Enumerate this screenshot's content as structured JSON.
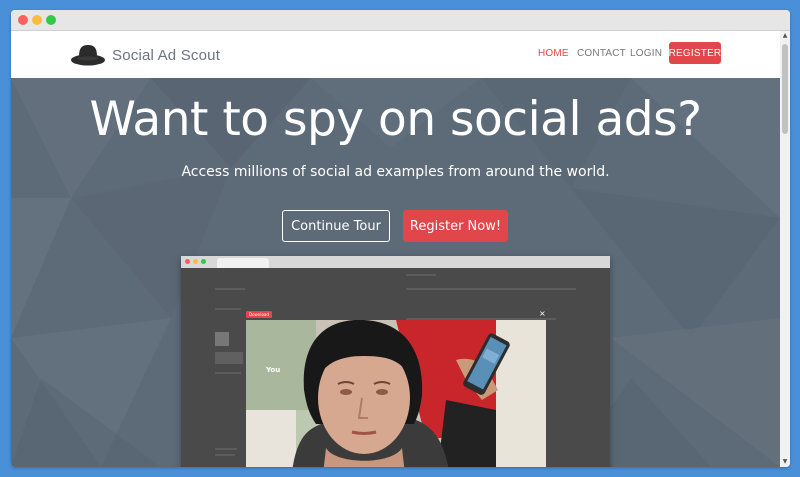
{
  "brand": {
    "name": "Social Ad Scout",
    "logo_icon": "hat-icon"
  },
  "nav": {
    "items": [
      {
        "label": "HOME",
        "active": true
      },
      {
        "label": "CONTACT",
        "active": false
      },
      {
        "label": "LOGIN",
        "active": false
      }
    ],
    "register_label": "REGISTER"
  },
  "hero": {
    "title": "Want to spy on social ads?",
    "subtitle": "Access millions of social ad examples from around the world.",
    "tour_button": "Continue Tour",
    "register_button": "Register Now!"
  },
  "preview": {
    "download_label": "Download",
    "video_caption": "You"
  },
  "colors": {
    "accent": "#e0464a",
    "hero_bg": "#5d6a78",
    "nav_text": "#777777",
    "active_nav": "#e24b4b"
  }
}
